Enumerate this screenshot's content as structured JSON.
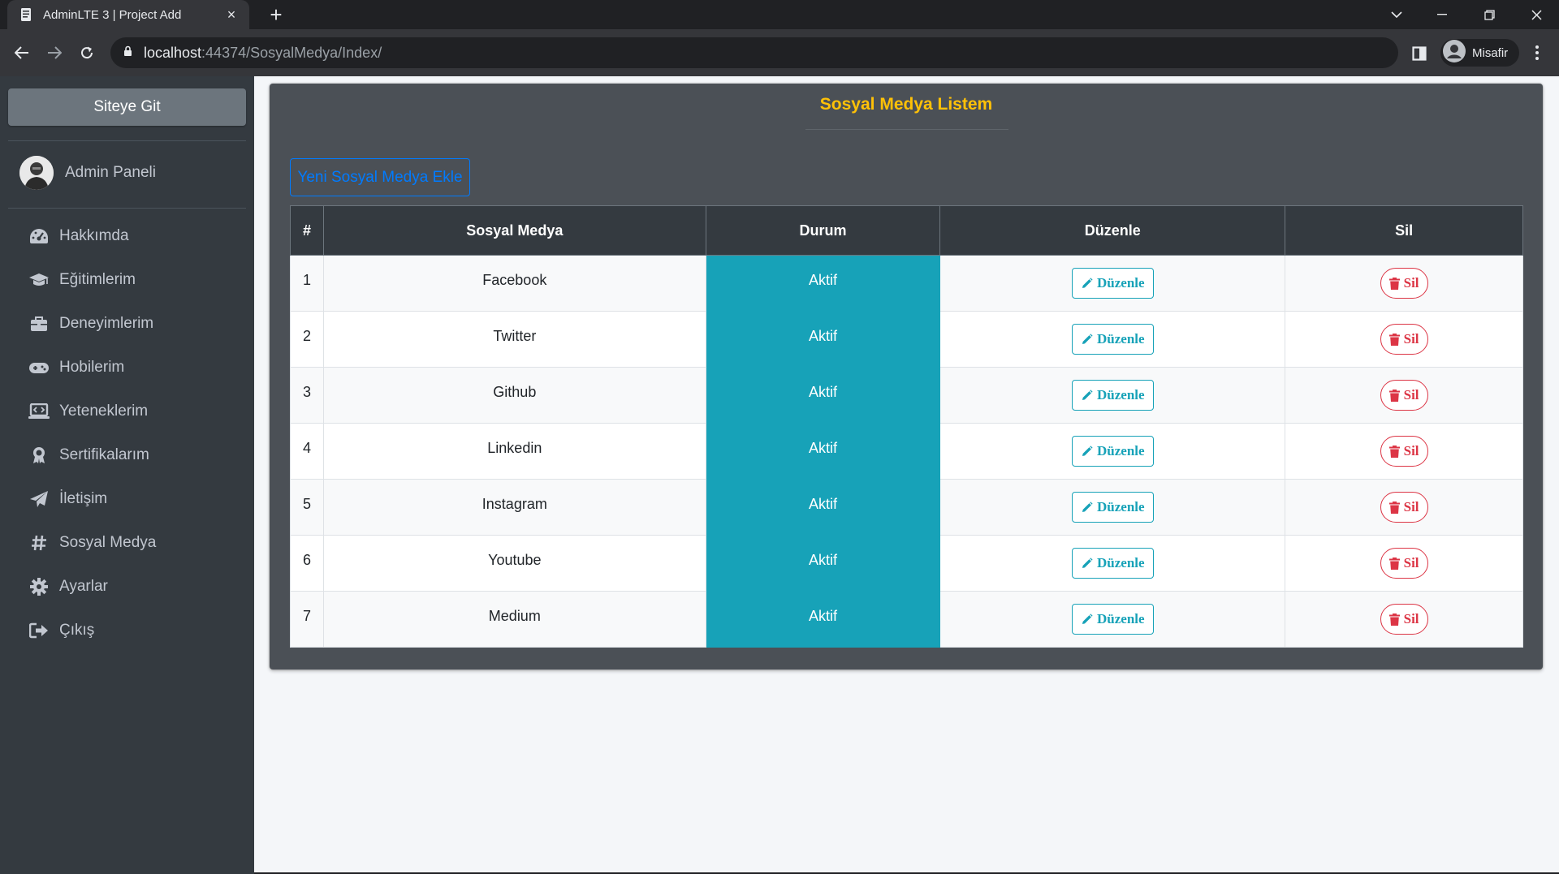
{
  "browser": {
    "tab_title": "AdminLTE 3 | Project Add",
    "tab_close": "×",
    "new_tab": "+",
    "url_host": "localhost",
    "url_path": ":44374/SosyalMedya/Index/",
    "profile_name": "Misafir"
  },
  "sidebar": {
    "site_button": "Siteye Git",
    "user_name": "Admin Paneli",
    "items": [
      {
        "label": "Hakkımda",
        "icon": "dashboard-icon"
      },
      {
        "label": "Eğitimlerim",
        "icon": "graduation-cap-icon"
      },
      {
        "label": "Deneyimlerim",
        "icon": "briefcase-icon"
      },
      {
        "label": "Hobilerim",
        "icon": "gamepad-icon"
      },
      {
        "label": "Yeteneklerim",
        "icon": "laptop-code-icon"
      },
      {
        "label": "Sertifikalarım",
        "icon": "award-icon"
      },
      {
        "label": "İletişim",
        "icon": "paper-plane-icon"
      },
      {
        "label": "Sosyal Medya",
        "icon": "hashtag-icon"
      },
      {
        "label": "Ayarlar",
        "icon": "cog-icon"
      },
      {
        "label": "Çıkış",
        "icon": "sign-out-icon"
      }
    ]
  },
  "main": {
    "title": "Sosyal Medya Listem",
    "add_button": "Yeni Sosyal Medya Ekle",
    "table": {
      "headers": [
        "#",
        "Sosyal Medya",
        "Durum",
        "Düzenle",
        "Sil"
      ],
      "edit_label": "Düzenle",
      "delete_label": "Sil",
      "rows": [
        {
          "id": "1",
          "name": "Facebook",
          "status": "Aktif"
        },
        {
          "id": "2",
          "name": "Twitter",
          "status": "Aktif"
        },
        {
          "id": "3",
          "name": "Github",
          "status": "Aktif"
        },
        {
          "id": "4",
          "name": "Linkedin",
          "status": "Aktif"
        },
        {
          "id": "5",
          "name": "Instagram",
          "status": "Aktif"
        },
        {
          "id": "6",
          "name": "Youtube",
          "status": "Aktif"
        },
        {
          "id": "7",
          "name": "Medium",
          "status": "Aktif"
        }
      ]
    }
  },
  "colors": {
    "title": "#ffc107",
    "primary": "#007bff",
    "info": "#17a2b8",
    "danger": "#dc3545",
    "sidebar": "#343a40"
  }
}
